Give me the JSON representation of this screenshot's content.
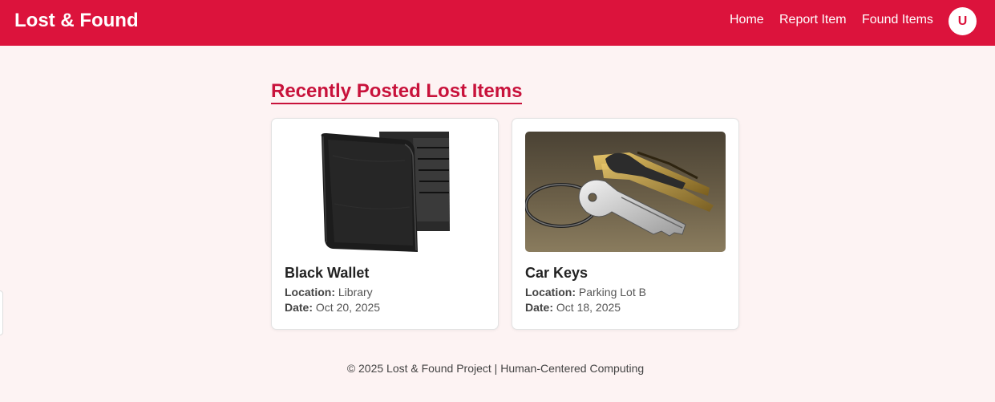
{
  "header": {
    "brand": "Lost & Found",
    "nav": [
      "Home",
      "Report Item",
      "Found Items"
    ],
    "avatar_initial": "U",
    "background": "#dc133c"
  },
  "main": {
    "section_title": "Recently Posted Lost Items",
    "items": [
      {
        "name": "Black Wallet",
        "location_label": "Location:",
        "location": "Library",
        "date_label": "Date:",
        "date": "Oct 20, 2025",
        "image": "wallet-image"
      },
      {
        "name": "Car Keys",
        "location_label": "Location:",
        "location": "Parking Lot B",
        "date_label": "Date:",
        "date": "Oct 18, 2025",
        "image": "car-keys-image"
      }
    ]
  },
  "footer": {
    "text": "© 2025 Lost & Found Project | Human-Centered Computing"
  },
  "colors": {
    "accent": "#dc133c",
    "heading": "#c8123b",
    "page_background": "#fdf3f3"
  }
}
